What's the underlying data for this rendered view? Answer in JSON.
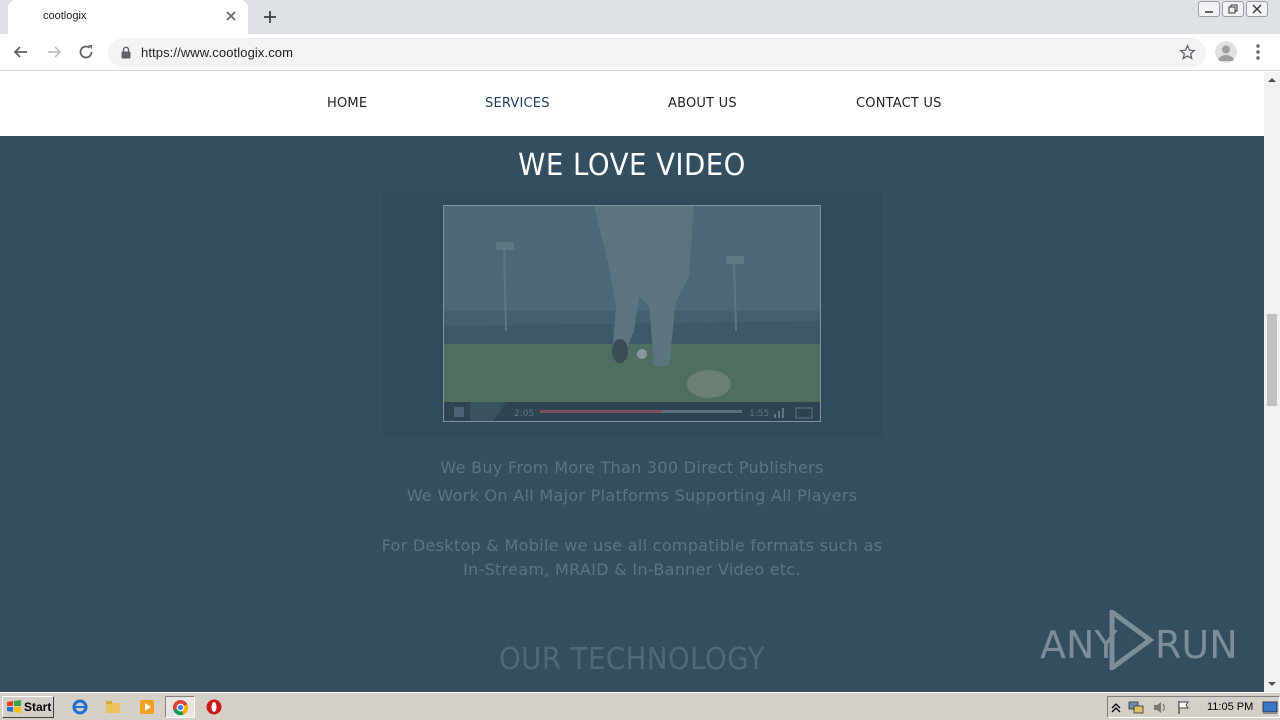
{
  "browser": {
    "tab_title": "cootlogix",
    "url": "https://www.cootlogix.com"
  },
  "site": {
    "nav": [
      "HOME",
      "SERVICES",
      "ABOUT US",
      "CONTACT US"
    ],
    "active_nav": "SERVICES",
    "headline": "WE LOVE VIDEO",
    "video": {
      "time_elapsed": "2:05",
      "time_remaining": "1:55",
      "progress_fraction": 0.6
    },
    "lines": [
      "We Buy From More Than 300 Direct Publishers",
      "We Work On All Major Platforms Supporting All Players",
      "For Desktop & Mobile we use all compatible formats such as",
      "In-Stream, MRAID & In-Banner Video etc."
    ],
    "section_title": "OUR TECHNOLOGY"
  },
  "watermark": {
    "left": "ANY",
    "right": "RUN"
  },
  "taskbar": {
    "start_label": "Start",
    "clock": "11:05 PM"
  },
  "colors": {
    "overlay": "#334e5f",
    "nav_bg": "#ffffff",
    "headline": "#ffffff"
  }
}
